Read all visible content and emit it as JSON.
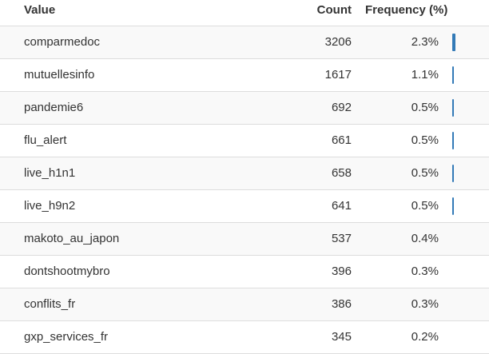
{
  "table": {
    "headers": {
      "value": "Value",
      "count": "Count",
      "frequency": "Frequency (%)"
    },
    "rows": [
      {
        "value": "comparmedoc",
        "count": "3206",
        "pct": "2.3%",
        "frequency": 2.3
      },
      {
        "value": "mutuellesinfo",
        "count": "1617",
        "pct": "1.1%",
        "frequency": 1.1
      },
      {
        "value": "pandemie6",
        "count": "692",
        "pct": "0.5%",
        "frequency": 0.5
      },
      {
        "value": "flu_alert",
        "count": "661",
        "pct": "0.5%",
        "frequency": 0.5
      },
      {
        "value": "live_h1n1",
        "count": "658",
        "pct": "0.5%",
        "frequency": 0.5
      },
      {
        "value": "live_h9n2",
        "count": "641",
        "pct": "0.5%",
        "frequency": 0.5
      },
      {
        "value": "makoto_au_japon",
        "count": "537",
        "pct": "0.4%",
        "frequency": 0.4
      },
      {
        "value": "dontshootmybro",
        "count": "396",
        "pct": "0.3%",
        "frequency": 0.3
      },
      {
        "value": "conflits_fr",
        "count": "386",
        "pct": "0.3%",
        "frequency": 0.3
      },
      {
        "value": "gxp_services_fr",
        "count": "345",
        "pct": "0.2%",
        "frequency": 0.2
      }
    ],
    "bar_color": "#337ab7",
    "stripe_color": "#f9f9f9"
  }
}
